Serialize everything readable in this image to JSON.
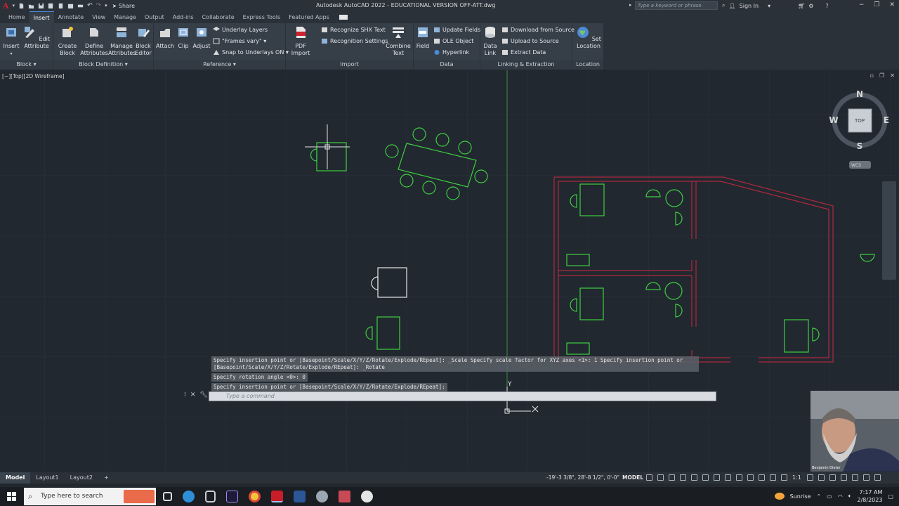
{
  "app": {
    "title": "Autodesk AutoCAD 2022 - EDUCATIONAL VERSION    OFF-ATT.dwg",
    "share_label": "Share",
    "search_placeholder": "Type a keyword or phrase",
    "signin_label": "Sign In",
    "accent": "#d0232f"
  },
  "tabs": [
    "Home",
    "Insert",
    "Annotate",
    "View",
    "Manage",
    "Output",
    "Add-ins",
    "Collaborate",
    "Express Tools",
    "Featured Apps"
  ],
  "active_tab": "Insert",
  "ribbon": {
    "block": {
      "insert": "Insert",
      "edit_attr1": "Edit",
      "edit_attr2": "Attribute",
      "footer": "Block ▾"
    },
    "block_def": {
      "create1": "Create",
      "create2": "Block",
      "define1": "Define",
      "define2": "Attributes",
      "manage1": "Manage",
      "manage2": "Attributes",
      "editor1": "Block",
      "editor2": "Editor",
      "footer": "Block Definition ▾"
    },
    "reference": {
      "attach": "Attach",
      "clip": "Clip",
      "adjust": "Adjust",
      "underlay": "Underlay Layers",
      "frames": "\"Frames vary\" ▾",
      "snap": "Snap to Underlays ON ▾",
      "footer": "Reference ▾"
    },
    "import": {
      "pdf1": "PDF",
      "pdf2": "Import",
      "shx": "Recognize SHX Text",
      "recog": "Recognition Settings",
      "combine1": "Combine",
      "combine2": "Text",
      "footer": "Import"
    },
    "data": {
      "field": "Field",
      "update": "Update Fields",
      "ole": "OLE Object",
      "hyperlink": "Hyperlink",
      "footer": "Data"
    },
    "linking": {
      "datalink1": "Data",
      "datalink2": "Link",
      "download": "Download from Source",
      "upload": "Upload to Source",
      "extract": "Extract  Data",
      "footer": "Linking & Extraction"
    },
    "location": {
      "set1": "Set",
      "set2": "Location",
      "footer": "Location"
    }
  },
  "viewport": {
    "label": "[−][Top][2D Wireframe]",
    "compass": {
      "n": "N",
      "s": "S",
      "e": "E",
      "w": "W",
      "center": "TOP",
      "wcs": "WCS"
    },
    "ucs": {
      "y": "Y",
      "x": "X"
    },
    "colors": {
      "furniture": "#3fcf3f",
      "walls": "#b0283c",
      "block": "#e6e6e6"
    }
  },
  "command": {
    "history": [
      "Specify insertion point or [Basepoint/Scale/X/Y/Z/Rotate/Explode/REpeat]: _Scale Specify scale factor for XYZ axes <1>: 1 Specify insertion point or",
      "[Basepoint/Scale/X/Y/Z/Rotate/Explode/REpeat]: _Rotate",
      "Specify rotation angle <0>: 0",
      "Specify insertion point or [Basepoint/Scale/X/Y/Z/Rotate/Explode/REpeat]:"
    ],
    "placeholder": "Type a command"
  },
  "status": {
    "layouts": [
      "Model",
      "Layout1",
      "Layout2"
    ],
    "active_layout": "Model",
    "coords": "-19'-3 3/8\", 28'-8 1/2\", 0'-0\"",
    "mode": "MODEL",
    "scale": "1:1"
  },
  "taskbar": {
    "search": "Type here to search",
    "weather": "Sunrise",
    "time": "7:17 AM",
    "date": "2/8/2023"
  },
  "webcam": {
    "name": "Benjamin Dieter"
  }
}
